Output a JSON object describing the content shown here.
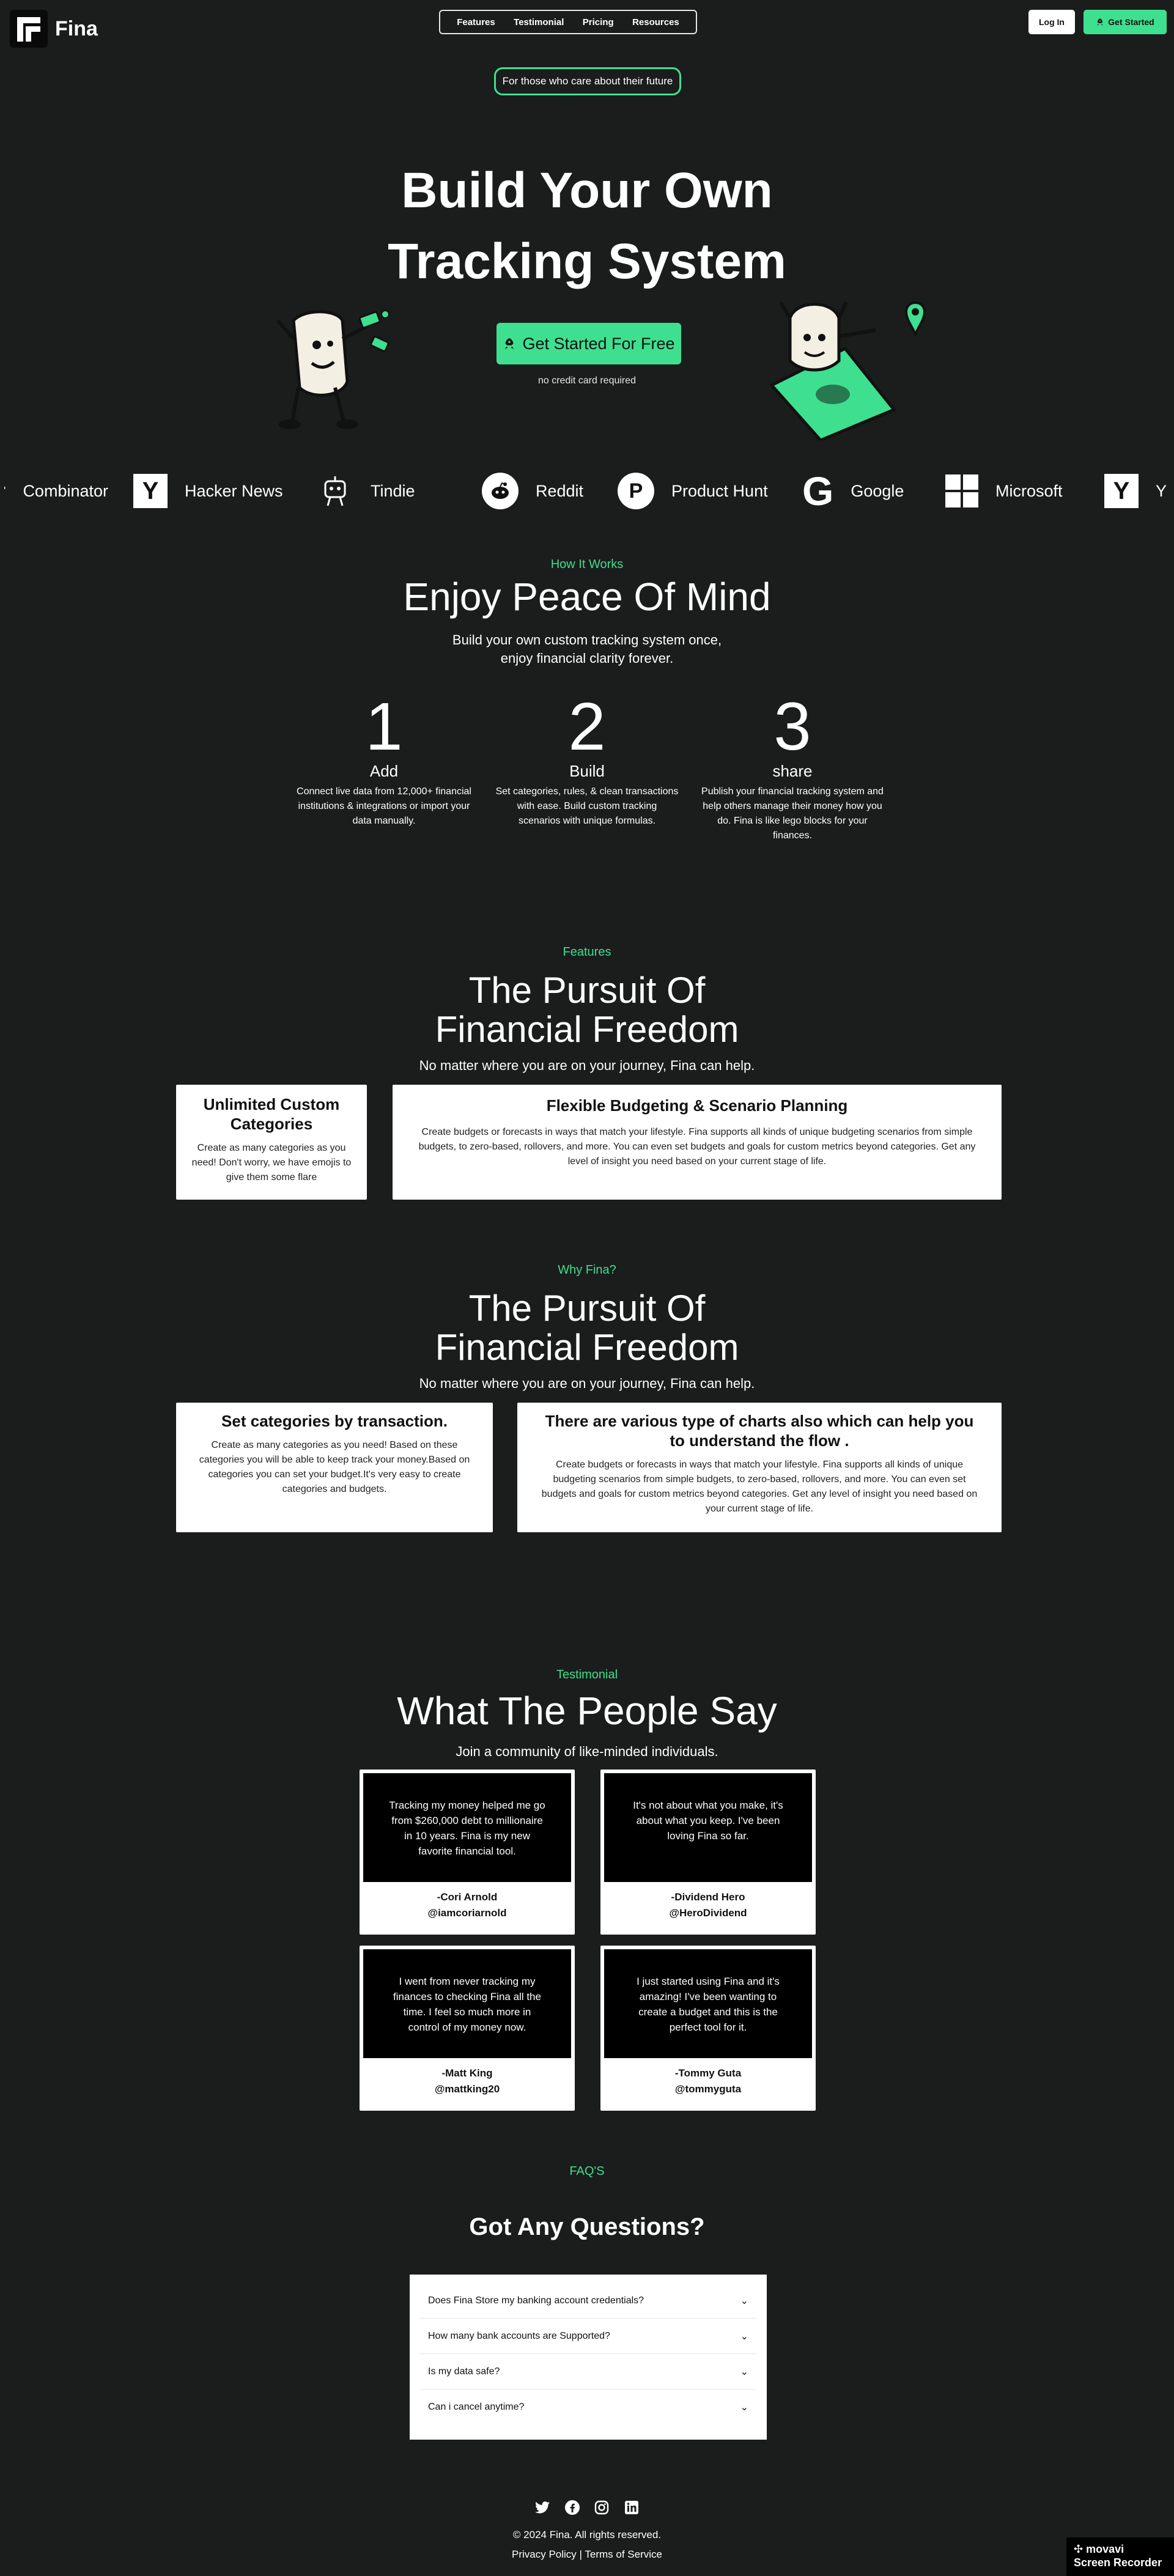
{
  "header": {
    "brand": "Fina",
    "nav": [
      "Features",
      "Testimonial",
      "Pricing",
      "Resources"
    ],
    "login": "Log In",
    "get_started": "Get Started"
  },
  "hero": {
    "pill": "For those who care about their future",
    "title_line1": "Build Your Own",
    "title_line2": "Tracking System",
    "cta": "Get Started For Free",
    "sub": "no credit card required"
  },
  "logos": [
    {
      "name": "Combinator",
      "icon": "y-combinator-icon"
    },
    {
      "name": "Hacker News",
      "icon": "y-square-icon"
    },
    {
      "name": "Tindie",
      "icon": "tindie-robot-icon"
    },
    {
      "name": "Reddit",
      "icon": "reddit-icon"
    },
    {
      "name": "Product Hunt",
      "icon": "product-hunt-icon"
    },
    {
      "name": "Google",
      "icon": "google-icon"
    },
    {
      "name": "Microsoft",
      "icon": "microsoft-icon"
    },
    {
      "name": "Y",
      "icon": "y-square-icon"
    }
  ],
  "how": {
    "eyebrow": "How It Works",
    "title": "Enjoy Peace Of Mind",
    "lead1": "Build your own custom tracking system once,",
    "lead2": "enjoy financial clarity forever.",
    "steps": [
      {
        "num": "1",
        "title": "Add",
        "text": "Connect live data from 12,000+ financial institutions & integrations or import your data manually."
      },
      {
        "num": "2",
        "title": "Build",
        "text": "Set categories, rules, & clean transactions with ease. Build custom tracking scenarios with unique formulas."
      },
      {
        "num": "3",
        "title": "share",
        "text": "Publish your financial tracking system and help others manage their money how you do. Fina is like lego blocks for your finances."
      }
    ]
  },
  "features": {
    "eyebrow": "Features",
    "title1": "The Pursuit Of",
    "title2": "Financial Freedom",
    "lead": "No matter where you are on your journey, Fina can help.",
    "card1_title": "Unlimited Custom Categories",
    "card1_text": "Create as many categories as you need! Don't worry, we have emojis to give them some flare",
    "card2_title": "Flexible Budgeting & Scenario Planning",
    "card2_text": "Create budgets or forecasts in ways that match your lifestyle. Fina supports all kinds of unique budgeting scenarios from simple budgets, to zero-based, rollovers, and more. You can even set budgets and goals for custom metrics beyond categories. Get any level of insight you need based on your current stage of life."
  },
  "why": {
    "eyebrow": "Why Fina?",
    "title1": "The Pursuit Of",
    "title2": "Financial Freedom",
    "lead": "No matter where you are on your journey, Fina can help.",
    "card1_title": "Set categories by transaction.",
    "card1_text": "Create as many categories as you need! Based on these categories you will be able to keep track your money.Based on categories you can set your budget.It's very easy to create categories and budgets.",
    "card2_title": "There are various type of charts also which can help you to understand the flow .",
    "card2_text": "Create budgets or forecasts in ways that match your lifestyle. Fina supports all kinds of unique budgeting scenarios from simple budgets, to zero-based, rollovers, and more. You can even set budgets and goals for custom metrics beyond categories. Get any level of insight you need based on your current stage of life."
  },
  "testimonials": {
    "eyebrow": "Testimonial",
    "title": "What The People Say",
    "lead": "Join a community of like-minded individuals.",
    "items": [
      {
        "quote": "Tracking my money helped me go from $260,000 debt to millionaire in 10 years. Fina is my new favorite financial tool.",
        "name": "-Cori Arnold",
        "handle": "@iamcoriarnold"
      },
      {
        "quote": "It's not about what you make, it's about what you keep. I've been loving Fina so far.",
        "name": "-Dividend Hero",
        "handle": "@HeroDividend"
      },
      {
        "quote": "I went from never tracking my finances to checking Fina all the time. I feel so much more in control of my money now.",
        "name": "-Matt King",
        "handle": "@mattking20"
      },
      {
        "quote": "I just started using Fina and it's amazing! I've been wanting to create a budget and this is the perfect tool for it.",
        "name": "-Tommy Guta",
        "handle": "@tommyguta"
      }
    ]
  },
  "faq": {
    "eyebrow": "FAQ'S",
    "title": "Got Any Questions?",
    "items": [
      "Does Fina Store my banking account credentials?",
      "How many bank accounts are Supported?",
      "Is my data safe?",
      "Can i cancel anytime?"
    ]
  },
  "footer": {
    "copyright": "© 2024 Fina. All rights reserved.",
    "privacy": "Privacy Policy",
    "sep": "|",
    "terms": "Terms of Service",
    "social": [
      "twitter-icon",
      "facebook-icon",
      "instagram-icon",
      "linkedin-icon"
    ]
  },
  "watermark": {
    "line1": "movavi",
    "line2": "Screen Recorder"
  },
  "colors": {
    "background": "#1b1c1c",
    "accent": "#3ee08f",
    "card": "#ffffff"
  }
}
